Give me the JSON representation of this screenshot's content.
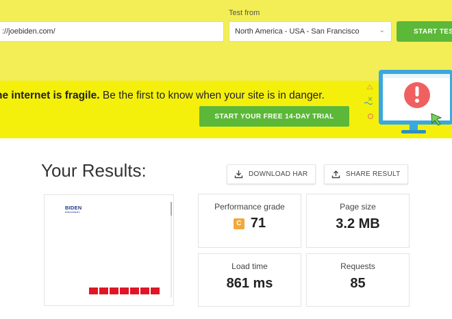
{
  "test_bar": {
    "url_value": "://joebiden.com/",
    "test_from_label": "Test from",
    "location_value": "North America - USA - San Francisco",
    "start_test_label": "START TEST"
  },
  "promo": {
    "headline_bold": "he internet is fragile.",
    "headline_rest": " Be the first to know when your site is in danger.",
    "trial_button_label": "START YOUR FREE 14-DAY TRIAL",
    "illustration_icon": "alert-monitor-illustration"
  },
  "results": {
    "title": "Your Results:",
    "download_label": "DOWNLOAD HAR",
    "share_label": "SHARE RESULT"
  },
  "thumbnail": {
    "logo_text": "BIDEN",
    "logo_subtext": "PRESIDENT"
  },
  "metrics": {
    "performance": {
      "label": "Performance grade",
      "grade": "C",
      "value": "71"
    },
    "page_size": {
      "label": "Page size",
      "value": "3.2 MB"
    },
    "load_time": {
      "label": "Load time",
      "value": "861 ms"
    },
    "requests": {
      "label": "Requests",
      "value": "85"
    }
  },
  "colors": {
    "brand_yellow": "#f4f00c",
    "pale_yellow": "#f3ee55",
    "cta_green": "#5cb838",
    "grade_c": "#f0a93b",
    "thumbnail_red": "#e01525"
  }
}
